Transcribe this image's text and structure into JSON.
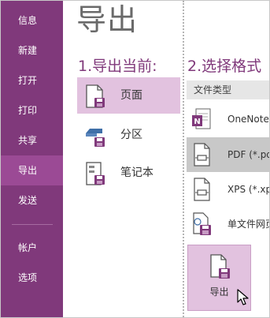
{
  "sidebar": {
    "items": [
      {
        "label": "信息"
      },
      {
        "label": "新建"
      },
      {
        "label": "打开"
      },
      {
        "label": "打印"
      },
      {
        "label": "共享"
      },
      {
        "label": "导出"
      },
      {
        "label": "发送"
      },
      {
        "label": "帐户"
      },
      {
        "label": "选项"
      }
    ],
    "active_label": "导出"
  },
  "page_title": "导出",
  "export_current": {
    "heading": "1.导出当前:",
    "options": [
      {
        "label": "页面",
        "icon": "page-icon",
        "selected": true
      },
      {
        "label": "分区",
        "icon": "section-icon",
        "selected": false
      },
      {
        "label": "笔记本",
        "icon": "notebook-icon",
        "selected": false
      }
    ]
  },
  "select_format": {
    "heading": "2.选择格式",
    "header": "文件类型",
    "items": [
      {
        "label": "OneNote",
        "icon": "onenote-icon",
        "selected": false
      },
      {
        "label": "PDF (*.pdf)",
        "icon": "pdf-icon",
        "selected": true
      },
      {
        "label": "XPS (*.xps)",
        "icon": "xps-icon",
        "selected": false
      },
      {
        "label": "单文件网页",
        "icon": "webpage-icon",
        "selected": false
      }
    ]
  },
  "export_button": {
    "label": "导出",
    "icon": "export-save-icon"
  },
  "colors": {
    "brand": "#80397b",
    "sidebar_active": "#9b4a95",
    "selection": "#e2c2df",
    "format_selected": "#c8c8c8"
  }
}
